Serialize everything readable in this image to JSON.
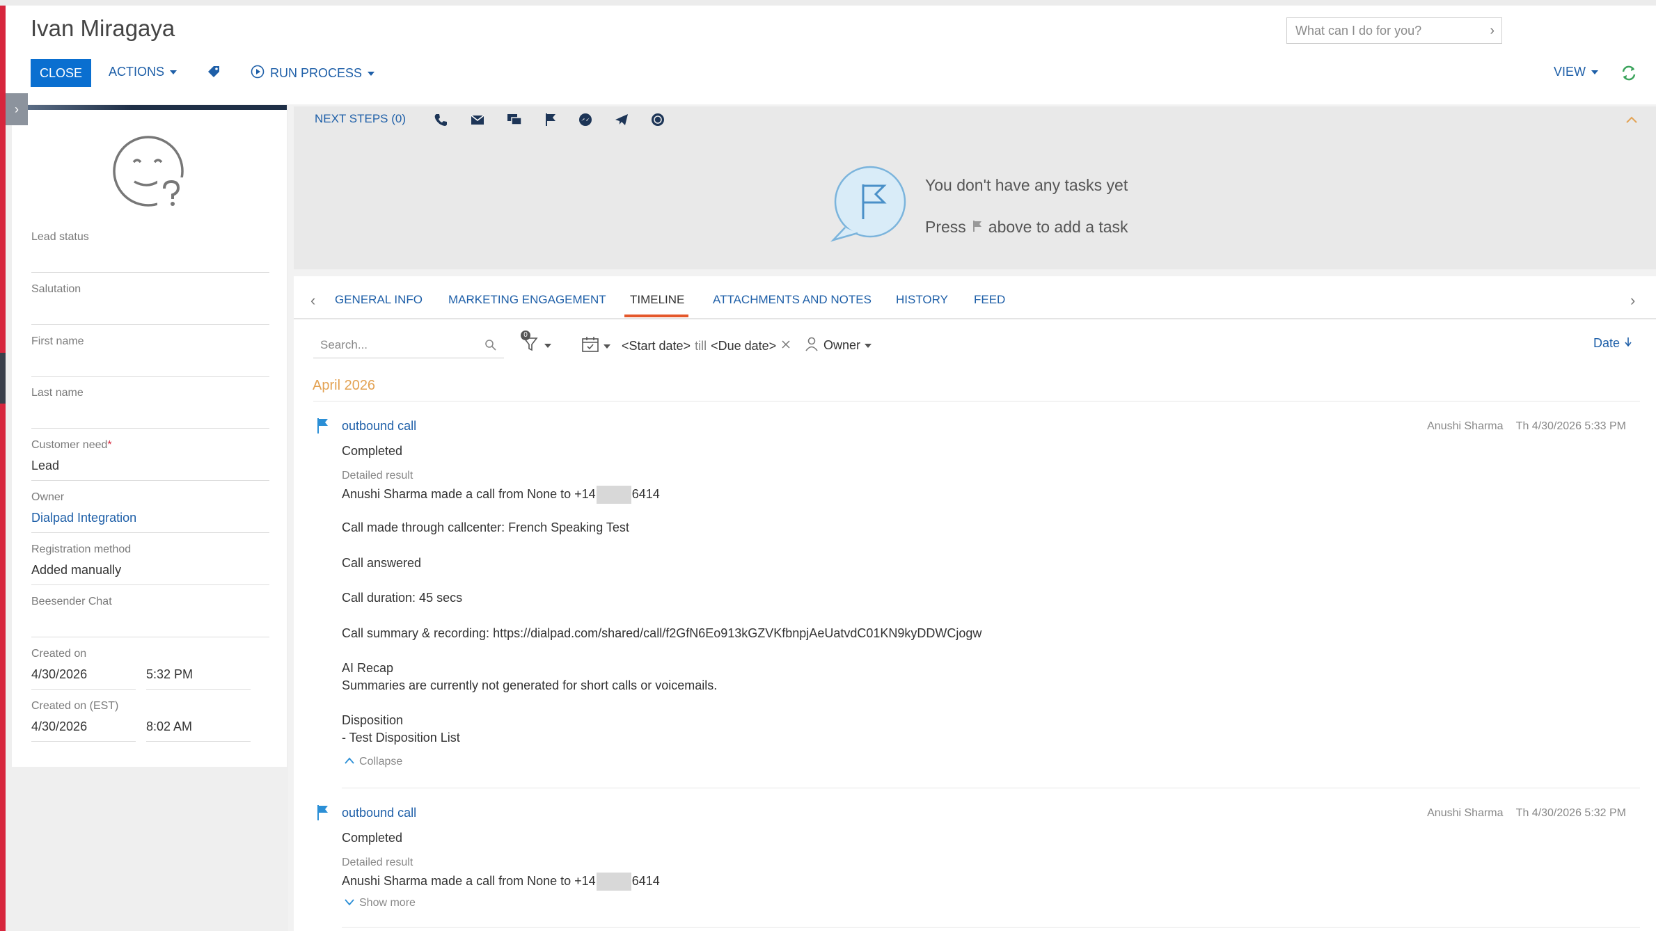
{
  "header": {
    "title": "Ivan Miragaya",
    "search_placeholder": "What can I do for you?",
    "close_label": "CLOSE",
    "actions_label": "ACTIONS",
    "run_process_label": "RUN PROCESS",
    "view_label": "VIEW"
  },
  "profile": {
    "fields": {
      "lead_status": {
        "label": "Lead status",
        "value": ""
      },
      "salutation": {
        "label": "Salutation",
        "value": ""
      },
      "first_name": {
        "label": "First name",
        "value": ""
      },
      "last_name": {
        "label": "Last name",
        "value": ""
      },
      "customer_need": {
        "label": "Customer need",
        "required_mark": "*",
        "value": "Lead"
      },
      "owner": {
        "label": "Owner",
        "value": "Dialpad Integration"
      },
      "registration_method": {
        "label": "Registration method",
        "value": "Added manually"
      },
      "beesender_chat": {
        "label": "Beesender Chat",
        "value": ""
      },
      "created_on": {
        "label": "Created on",
        "date": "4/30/2026",
        "time": "5:32 PM"
      },
      "created_on_est": {
        "label": "Created on (EST)",
        "date": "4/30/2026",
        "time": "8:02 AM"
      }
    }
  },
  "next_steps": {
    "label": "NEXT STEPS (0)",
    "icons": [
      "phone-icon",
      "email-icon",
      "chat-icon",
      "flag-icon",
      "messenger-icon",
      "telegram-icon",
      "whatsapp-icon"
    ],
    "empty_title": "You don't have any tasks yet",
    "empty_hint_before": "Press",
    "empty_hint_after": "above to add a task"
  },
  "tabs": {
    "items": [
      "GENERAL INFO",
      "MARKETING ENGAGEMENT",
      "TIMELINE",
      "ATTACHMENTS AND NOTES",
      "HISTORY",
      "FEED"
    ],
    "active": "TIMELINE"
  },
  "timeline": {
    "search_placeholder": "Search...",
    "filter_badge": "0",
    "start_date": "<Start date>",
    "till": "till",
    "due_date": "<Due date>",
    "owner_filter": "Owner",
    "sort_label": "Date",
    "month": "April 2026",
    "entries": [
      {
        "title": "outbound call",
        "author": "Anushi Sharma",
        "timestamp": "Th 4/30/2026 5:33 PM",
        "status": "Completed",
        "result_label": "Detailed result",
        "call_line_prefix": "Anushi Sharma made a call from None to +14",
        "call_line_suffix": "6414",
        "callcenter": "Call made through callcenter: French Speaking Test",
        "answered": "Call answered",
        "duration": "Call duration: 45 secs",
        "summary": "Call summary & recording: https://dialpad.com/shared/call/f2GfN6Eo913kGZVKfbnpjAeUatvdC01KN9kyDDWCjogw",
        "ai_recap_label": "AI Recap",
        "ai_recap_text": "Summaries are currently not generated for short calls or voicemails.",
        "disposition_label": "Disposition",
        "disposition_value": "- Test Disposition List",
        "toggle_label": "Collapse"
      },
      {
        "title": "outbound call",
        "author": "Anushi Sharma",
        "timestamp": "Th 4/30/2026 5:32 PM",
        "status": "Completed",
        "result_label": "Detailed result",
        "call_line_prefix": "Anushi Sharma made a call from None to +14",
        "call_line_suffix": "6414",
        "toggle_label": "Show more"
      }
    ]
  },
  "colors": {
    "accent_blue": "#0a6fd0",
    "link_blue": "#1e5fa8",
    "active_tab_underline": "#e4582b",
    "month_orange": "#e3a253",
    "left_edge_red": "#d7263d",
    "refresh_green": "#3aa35b"
  }
}
